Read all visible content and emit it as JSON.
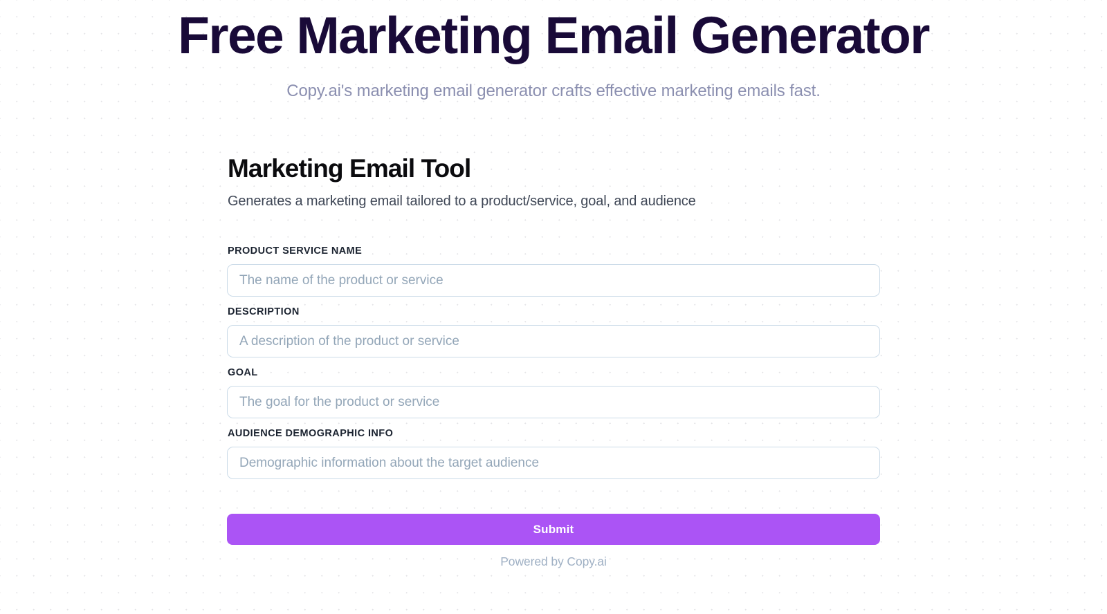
{
  "hero": {
    "title": "Free Marketing Email Generator",
    "subtitle": "Copy.ai's marketing email generator crafts effective marketing emails fast."
  },
  "tool": {
    "title": "Marketing Email Tool",
    "description": "Generates a marketing email tailored to a product/service, goal, and audience"
  },
  "form": {
    "fields": [
      {
        "label": "PRODUCT SERVICE NAME",
        "placeholder": "The name of the product or service",
        "value": ""
      },
      {
        "label": "DESCRIPTION",
        "placeholder": "A description of the product or service",
        "value": ""
      },
      {
        "label": "GOAL",
        "placeholder": "The goal for the product or service",
        "value": ""
      },
      {
        "label": "AUDIENCE DEMOGRAPHIC INFO",
        "placeholder": "Demographic information about the target audience",
        "value": ""
      }
    ],
    "submit_label": "Submit"
  },
  "footer": {
    "powered_by": "Powered by Copy.ai"
  },
  "colors": {
    "heading": "#190a38",
    "subtitle": "#8b8fb0",
    "accent_purple": "#ab54f5",
    "input_border": "#cbdbe8",
    "placeholder": "#93a6b8",
    "label": "#1b2330",
    "footer_text": "#9fb0c4",
    "background": "#ffffff",
    "dot_grid": "#e4e4e7"
  }
}
